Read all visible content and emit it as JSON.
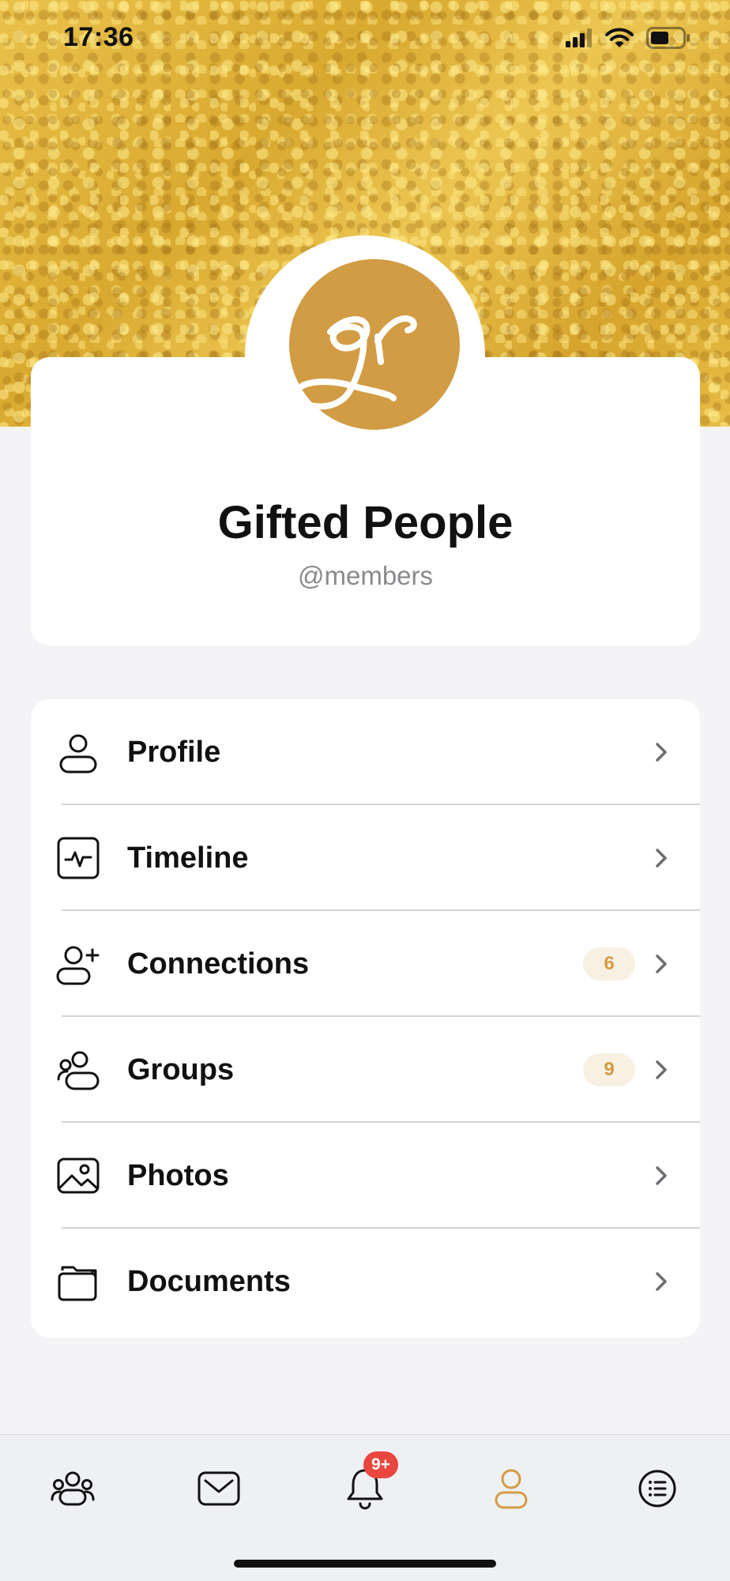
{
  "status_bar": {
    "time": "17:36",
    "icons": [
      "cellular-signal-icon",
      "wifi-icon",
      "battery-icon"
    ]
  },
  "cover": {
    "texture": "gold-glitter"
  },
  "profile": {
    "avatar_icon": "gifted-people-logo",
    "avatar_color": "#d29c44",
    "name": "Gifted People",
    "handle": "@members"
  },
  "menu": {
    "items": [
      {
        "label": "Profile",
        "icon": "user-icon",
        "badge": ""
      },
      {
        "label": "Timeline",
        "icon": "activity-icon",
        "badge": ""
      },
      {
        "label": "Connections",
        "icon": "add-user-icon",
        "badge": "6"
      },
      {
        "label": "Groups",
        "icon": "group-icon",
        "badge": "9"
      },
      {
        "label": "Photos",
        "icon": "image-icon",
        "badge": ""
      },
      {
        "label": "Documents",
        "icon": "folder-icon",
        "badge": ""
      }
    ]
  },
  "tab_bar": {
    "tabs": [
      {
        "id": "members",
        "icon": "members-icon",
        "active": false
      },
      {
        "id": "messages",
        "icon": "mail-icon",
        "active": false
      },
      {
        "id": "notifications",
        "icon": "bell-icon",
        "active": false,
        "badge": "9+"
      },
      {
        "id": "profile",
        "icon": "profile-icon",
        "active": true
      },
      {
        "id": "more",
        "icon": "list-icon",
        "active": false
      }
    ],
    "active_color": "#d29c44",
    "badge_color": "#e8463f"
  }
}
